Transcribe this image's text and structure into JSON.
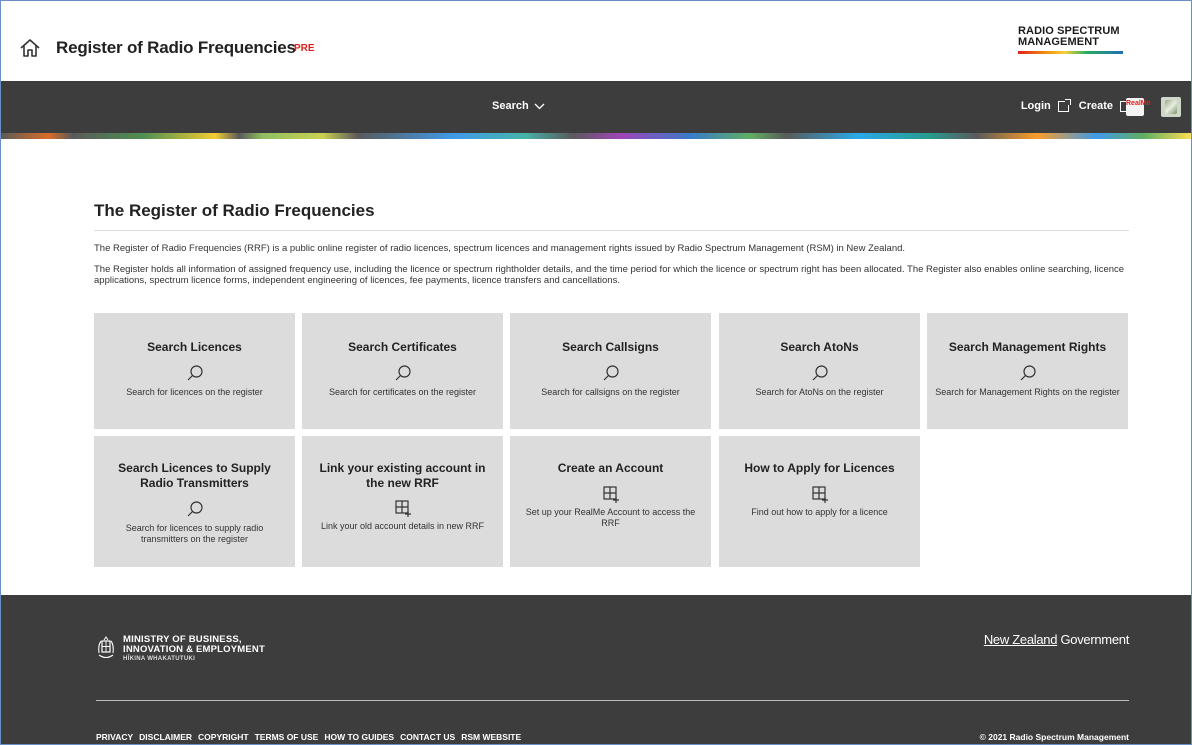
{
  "header": {
    "title": "Register of Radio Frequencies",
    "env_badge": "PRE",
    "brand_line1": "RADIO SPECTRUM",
    "brand_line2": "MANAGEMENT"
  },
  "nav": {
    "search_label": "Search",
    "login_label": "Login",
    "create_label": "Create",
    "realme_icon": "RealMe",
    "icons": [
      "home-icon",
      "chevron-down-icon",
      "external-link-icon",
      "realme-icon",
      "nz-government-icon"
    ]
  },
  "main": {
    "title": "The Register of Radio Frequencies",
    "intro1": "The Register of Radio Frequencies (RRF) is a public online register of radio licences, spectrum licences and management rights issued by Radio Spectrum Management (RSM) in New Zealand.",
    "intro2": "The Register holds all information of assigned frequency use, including the licence or spectrum rightholder details, and the time period for which the licence or spectrum right has been allocated. The Register also enables online searching, licence applications, spectrum licence forms, independent engineering of licences, fee payments, licence transfers and cancellations.",
    "tiles": [
      {
        "title": "Search Licences",
        "icon": "search-icon",
        "desc": "Search for licences on the register"
      },
      {
        "title": "Search Certificates",
        "icon": "search-icon",
        "desc": "Search for certificates on the register"
      },
      {
        "title": "Search Callsigns",
        "icon": "search-icon",
        "desc": "Search for callsigns on the register"
      },
      {
        "title": "Search AtoNs",
        "icon": "search-icon",
        "desc": "Search for AtoNs on the register"
      },
      {
        "title": "Search Management Rights",
        "icon": "search-icon",
        "desc": "Search for Management Rights on the register"
      },
      {
        "title": "Search Licences to Supply Radio Transmitters",
        "icon": "search-icon",
        "desc": "Search for licences to supply radio transmitters on the register"
      },
      {
        "title": "Link your existing account in the new RRF",
        "icon": "add-grid-icon",
        "desc": "Link your old account details in new RRF"
      },
      {
        "title": "Create an Account",
        "icon": "add-grid-icon",
        "desc": "Set up your RealMe Account to access the RRF"
      },
      {
        "title": "How to Apply for Licences",
        "icon": "add-grid-icon",
        "desc": "Find out how to apply for a licence"
      }
    ]
  },
  "footer": {
    "mbie_line1": "MINISTRY OF BUSINESS,",
    "mbie_line2": "INNOVATION & EMPLOYMENT",
    "mbie_sub": "HĪKINA WHAKATUTUKI",
    "nzgov_part1": "New Zealand",
    "nzgov_part2": " Government",
    "links": [
      "PRIVACY",
      "DISCLAIMER",
      "COPYRIGHT",
      "TERMS OF USE",
      "HOW TO GUIDES",
      "CONTACT US",
      "RSM WEBSITE"
    ],
    "copyright": "© 2021 Radio Spectrum Management"
  },
  "colors": {
    "nav_bg": "#3d3d3d",
    "tile_bg": "#dcdcdc",
    "badge_red": "#e0201b"
  }
}
